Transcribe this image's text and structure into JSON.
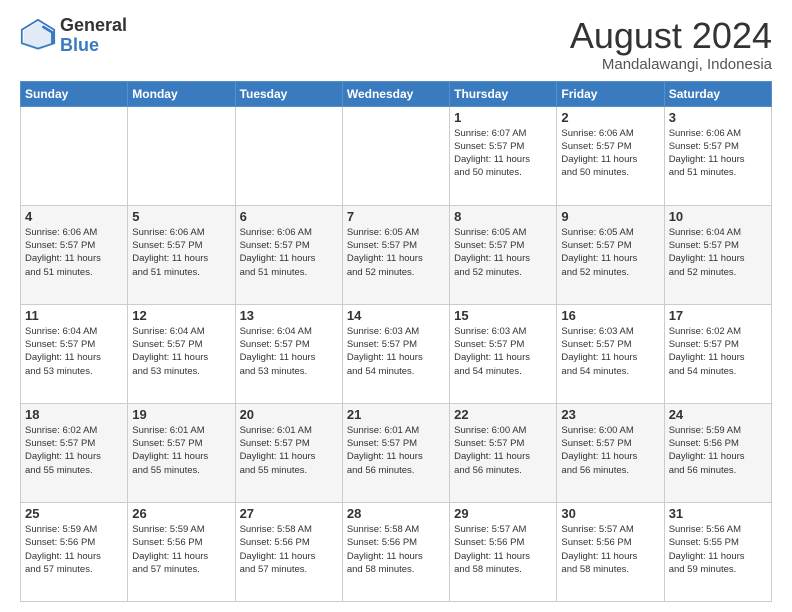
{
  "header": {
    "logo_general": "General",
    "logo_blue": "Blue",
    "month_year": "August 2024",
    "location": "Mandalawangi, Indonesia"
  },
  "weekdays": [
    "Sunday",
    "Monday",
    "Tuesday",
    "Wednesday",
    "Thursday",
    "Friday",
    "Saturday"
  ],
  "weeks": [
    [
      {
        "day": "",
        "info": ""
      },
      {
        "day": "",
        "info": ""
      },
      {
        "day": "",
        "info": ""
      },
      {
        "day": "",
        "info": ""
      },
      {
        "day": "1",
        "info": "Sunrise: 6:07 AM\nSunset: 5:57 PM\nDaylight: 11 hours\nand 50 minutes."
      },
      {
        "day": "2",
        "info": "Sunrise: 6:06 AM\nSunset: 5:57 PM\nDaylight: 11 hours\nand 50 minutes."
      },
      {
        "day": "3",
        "info": "Sunrise: 6:06 AM\nSunset: 5:57 PM\nDaylight: 11 hours\nand 51 minutes."
      }
    ],
    [
      {
        "day": "4",
        "info": "Sunrise: 6:06 AM\nSunset: 5:57 PM\nDaylight: 11 hours\nand 51 minutes."
      },
      {
        "day": "5",
        "info": "Sunrise: 6:06 AM\nSunset: 5:57 PM\nDaylight: 11 hours\nand 51 minutes."
      },
      {
        "day": "6",
        "info": "Sunrise: 6:06 AM\nSunset: 5:57 PM\nDaylight: 11 hours\nand 51 minutes."
      },
      {
        "day": "7",
        "info": "Sunrise: 6:05 AM\nSunset: 5:57 PM\nDaylight: 11 hours\nand 52 minutes."
      },
      {
        "day": "8",
        "info": "Sunrise: 6:05 AM\nSunset: 5:57 PM\nDaylight: 11 hours\nand 52 minutes."
      },
      {
        "day": "9",
        "info": "Sunrise: 6:05 AM\nSunset: 5:57 PM\nDaylight: 11 hours\nand 52 minutes."
      },
      {
        "day": "10",
        "info": "Sunrise: 6:04 AM\nSunset: 5:57 PM\nDaylight: 11 hours\nand 52 minutes."
      }
    ],
    [
      {
        "day": "11",
        "info": "Sunrise: 6:04 AM\nSunset: 5:57 PM\nDaylight: 11 hours\nand 53 minutes."
      },
      {
        "day": "12",
        "info": "Sunrise: 6:04 AM\nSunset: 5:57 PM\nDaylight: 11 hours\nand 53 minutes."
      },
      {
        "day": "13",
        "info": "Sunrise: 6:04 AM\nSunset: 5:57 PM\nDaylight: 11 hours\nand 53 minutes."
      },
      {
        "day": "14",
        "info": "Sunrise: 6:03 AM\nSunset: 5:57 PM\nDaylight: 11 hours\nand 54 minutes."
      },
      {
        "day": "15",
        "info": "Sunrise: 6:03 AM\nSunset: 5:57 PM\nDaylight: 11 hours\nand 54 minutes."
      },
      {
        "day": "16",
        "info": "Sunrise: 6:03 AM\nSunset: 5:57 PM\nDaylight: 11 hours\nand 54 minutes."
      },
      {
        "day": "17",
        "info": "Sunrise: 6:02 AM\nSunset: 5:57 PM\nDaylight: 11 hours\nand 54 minutes."
      }
    ],
    [
      {
        "day": "18",
        "info": "Sunrise: 6:02 AM\nSunset: 5:57 PM\nDaylight: 11 hours\nand 55 minutes."
      },
      {
        "day": "19",
        "info": "Sunrise: 6:01 AM\nSunset: 5:57 PM\nDaylight: 11 hours\nand 55 minutes."
      },
      {
        "day": "20",
        "info": "Sunrise: 6:01 AM\nSunset: 5:57 PM\nDaylight: 11 hours\nand 55 minutes."
      },
      {
        "day": "21",
        "info": "Sunrise: 6:01 AM\nSunset: 5:57 PM\nDaylight: 11 hours\nand 56 minutes."
      },
      {
        "day": "22",
        "info": "Sunrise: 6:00 AM\nSunset: 5:57 PM\nDaylight: 11 hours\nand 56 minutes."
      },
      {
        "day": "23",
        "info": "Sunrise: 6:00 AM\nSunset: 5:57 PM\nDaylight: 11 hours\nand 56 minutes."
      },
      {
        "day": "24",
        "info": "Sunrise: 5:59 AM\nSunset: 5:56 PM\nDaylight: 11 hours\nand 56 minutes."
      }
    ],
    [
      {
        "day": "25",
        "info": "Sunrise: 5:59 AM\nSunset: 5:56 PM\nDaylight: 11 hours\nand 57 minutes."
      },
      {
        "day": "26",
        "info": "Sunrise: 5:59 AM\nSunset: 5:56 PM\nDaylight: 11 hours\nand 57 minutes."
      },
      {
        "day": "27",
        "info": "Sunrise: 5:58 AM\nSunset: 5:56 PM\nDaylight: 11 hours\nand 57 minutes."
      },
      {
        "day": "28",
        "info": "Sunrise: 5:58 AM\nSunset: 5:56 PM\nDaylight: 11 hours\nand 58 minutes."
      },
      {
        "day": "29",
        "info": "Sunrise: 5:57 AM\nSunset: 5:56 PM\nDaylight: 11 hours\nand 58 minutes."
      },
      {
        "day": "30",
        "info": "Sunrise: 5:57 AM\nSunset: 5:56 PM\nDaylight: 11 hours\nand 58 minutes."
      },
      {
        "day": "31",
        "info": "Sunrise: 5:56 AM\nSunset: 5:55 PM\nDaylight: 11 hours\nand 59 minutes."
      }
    ]
  ]
}
